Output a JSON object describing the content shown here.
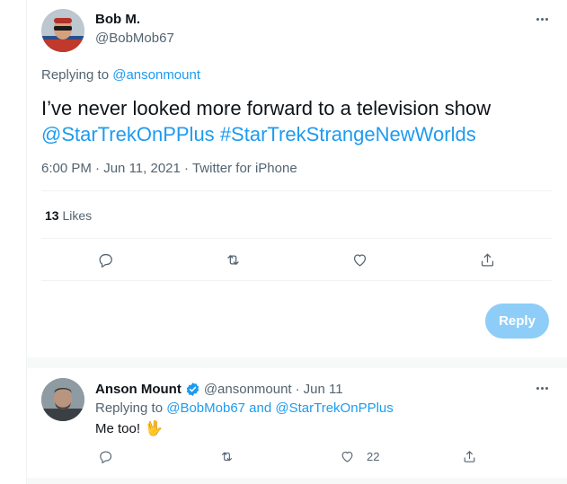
{
  "tweet": {
    "author_name": "Bob M.",
    "author_handle": "@BobMob67",
    "replying_prefix": "Replying to",
    "replying_to": "@ansonmount",
    "text_line1": "I’ve never looked more forward to a television show",
    "mention": "@StarTrekOnPPlus",
    "hashtag": "#StarTrekStrangeNewWorlds",
    "time": "6:00 PM",
    "date": "Jun 11, 2021",
    "source": "Twitter for iPhone",
    "likes_count": "13",
    "likes_label": "Likes"
  },
  "actions": {
    "reply_icon": "reply-icon",
    "retweet_icon": "retweet-icon",
    "like_icon": "like-icon",
    "share_icon": "share-icon"
  },
  "compose": {
    "reply_label": "Reply"
  },
  "reply": {
    "author_name": "Anson Mount",
    "verified": "verified-badge-icon",
    "author_handle": "@ansonmount",
    "date": "Jun 11",
    "replying_prefix": "Replying to",
    "replying_to_1": "@BobMob67",
    "replying_and": "and",
    "replying_to_2": "@StarTrekOnPPlus",
    "text": "Me too!",
    "emoji": "🖖",
    "like_count": "22"
  },
  "colors": {
    "accent": "#1d9bf0",
    "reply_button_disabled": "#8ecdf8",
    "muted_text": "#536471"
  }
}
